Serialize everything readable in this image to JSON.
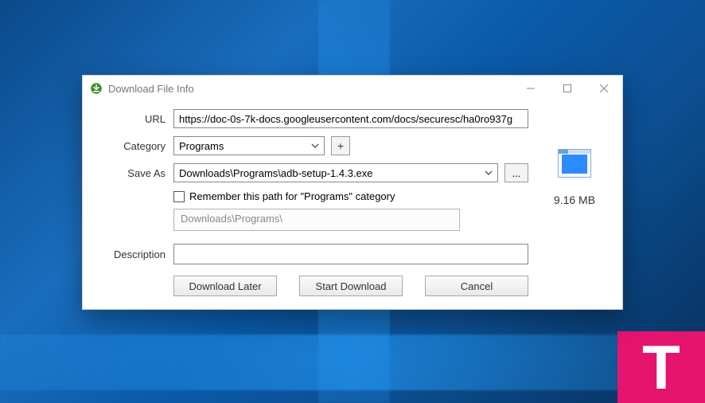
{
  "window": {
    "title": "Download File Info"
  },
  "form": {
    "url_label": "URL",
    "url_value": "https://doc-0s-7k-docs.googleusercontent.com/docs/securesc/ha0ro937g",
    "category_label": "Category",
    "category_value": "Programs",
    "add_category_label": "+",
    "saveas_label": "Save As",
    "saveas_value": "Downloads\\Programs\\adb-setup-1.4.3.exe",
    "browse_label": "...",
    "remember_label": "Remember this path for \"Programs\" category",
    "remember_checked": false,
    "path_display": "Downloads\\Programs\\",
    "description_label": "Description",
    "description_value": ""
  },
  "file": {
    "size_text": "9.16  MB"
  },
  "buttons": {
    "later": "Download Later",
    "start": "Start Download",
    "cancel": "Cancel"
  },
  "badge": {
    "text": "T"
  }
}
